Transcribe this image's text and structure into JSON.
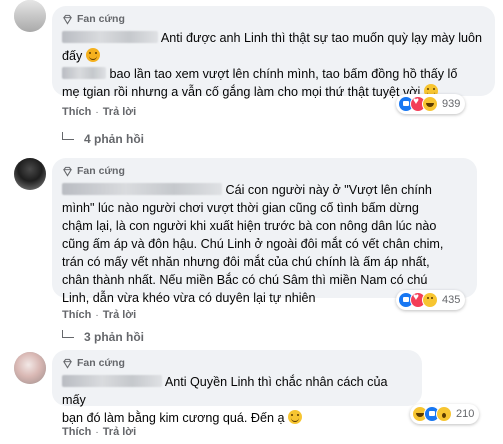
{
  "comments": [
    {
      "badge": "Fan cứng",
      "text_a": "Anti được anh Linh thì thật sự tao muốn quỳ lạy mày luôn",
      "text_b": "đấy",
      "text_c": "bao lần tao xem vượt lên chính mình, tao bấm đồng hồ thấy lố",
      "text_d": "mẹ tgian rồi nhưng a vẫn cố gắng làm cho mọi thứ thật tuyệt vời",
      "reaction_count": "939",
      "like": "Thích",
      "reply": "Trả lời",
      "replies": "4 phản hồi"
    },
    {
      "badge": "Fan cứng",
      "text_a": "Cái con người này ở \"Vượt lên chính",
      "text_b": "mình\" lúc nào người chơi vượt thời gian cũng cố tình bấm dừng",
      "text_c": "chậm lại, là con người khi xuất hiện trước bà con nông dân lúc nào",
      "text_d": "cũng ấm áp và đôn hậu. Chú Linh ở ngoài đôi mắt có vết chân chim,",
      "text_e": "trán có mấy vết nhăn nhưng đôi mắt của chú chính là ấm áp nhất,",
      "text_f": "chân thành nhất. Nếu miền Bắc có chú Sâm thì miền Nam có chú",
      "text_g": "Linh, dẫn vừa khéo vừa có duyên lại tự nhiên",
      "reaction_count": "435",
      "like": "Thích",
      "reply": "Trả lời",
      "replies": "3 phản hồi"
    },
    {
      "badge": "Fan cứng",
      "text_a": "Anti Quyền Linh thì chắc nhân cách của mấy",
      "text_b": "bạn đó làm bằng kim cương quá. Đến ạ",
      "reaction_count": "210",
      "like": "Thích",
      "reply": "Trả lời"
    }
  ],
  "sep": "·"
}
